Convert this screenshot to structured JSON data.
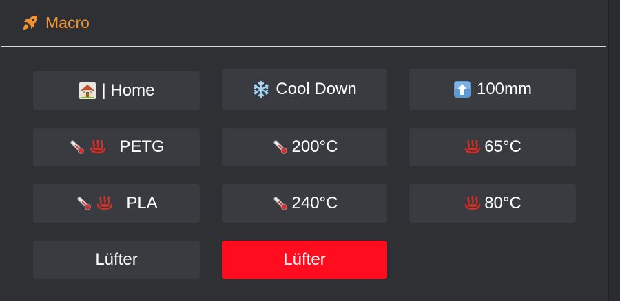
{
  "header": {
    "title": "Macro",
    "icon": "rocket-icon",
    "accent_color": "#f5922e"
  },
  "buttons": {
    "home": {
      "label": "| Home",
      "icon": "house-icon"
    },
    "cooldown": {
      "label": "Cool Down",
      "icon": "snowflake-icon"
    },
    "move_up": {
      "label": "100mm",
      "icon": "arrow-up-icon"
    },
    "petg": {
      "label": "PETG",
      "icons": [
        "thermometer-icon",
        "hot-springs-icon"
      ]
    },
    "nozzle_200": {
      "label": "200°C",
      "icon": "thermometer-icon"
    },
    "bed_65": {
      "label": "65°C",
      "icon": "hot-springs-icon"
    },
    "pla": {
      "label": "PLA",
      "icons": [
        "thermometer-icon",
        "hot-springs-icon"
      ]
    },
    "nozzle_240": {
      "label": "240°C",
      "icon": "thermometer-icon"
    },
    "bed_80": {
      "label": "80°C",
      "icon": "hot-springs-icon"
    },
    "fan_on": {
      "label": "Lüfter"
    },
    "fan_off": {
      "label": "Lüfter",
      "color": "#ff0d1f"
    }
  }
}
